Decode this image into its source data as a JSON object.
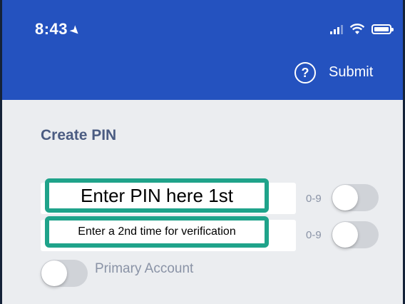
{
  "status_bar": {
    "time": "8:43",
    "location_icon": "location-arrow-icon",
    "signal_icon": "signal-icon",
    "wifi_icon": "wifi-icon",
    "battery_icon": "battery-icon"
  },
  "header": {
    "help_icon": "help-icon",
    "help_glyph": "?",
    "submit_label": "Submit"
  },
  "form": {
    "title": "Create PIN",
    "pin_first": {
      "callout": "Enter PIN here 1st",
      "hint": "0-9"
    },
    "pin_second": {
      "callout": "Enter a 2nd time for verification",
      "hint": "0-9"
    },
    "primary_account": {
      "label": "Primary Account"
    }
  },
  "colors": {
    "header": "#2452bf",
    "background": "#ebedf0",
    "callout_border": "#1fa38a",
    "title": "#4b5c82"
  }
}
